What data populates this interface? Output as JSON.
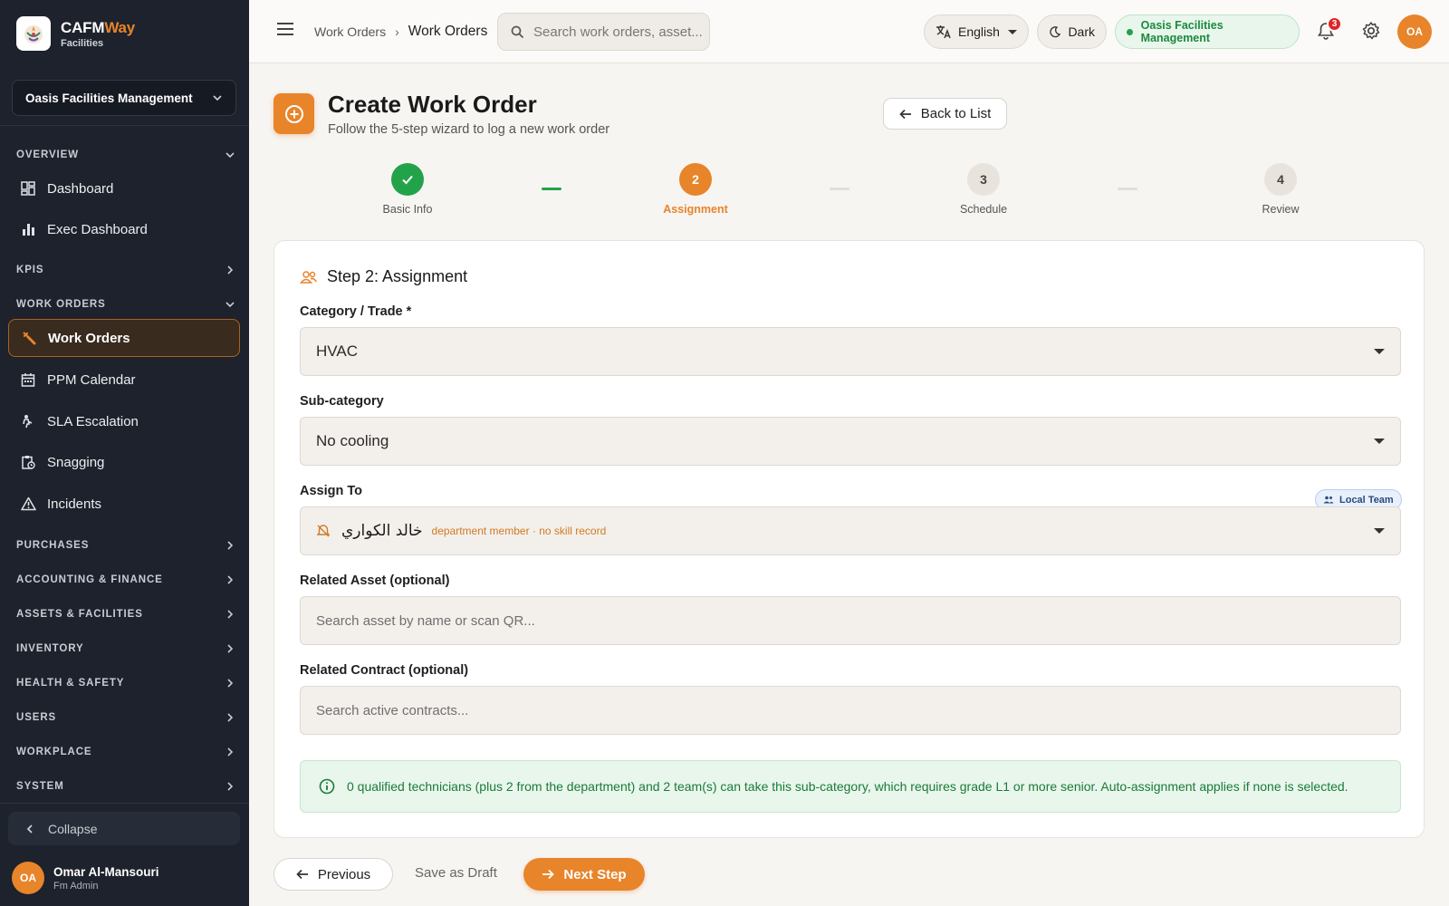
{
  "brand": {
    "name": "CAFM",
    "name_accent": "Way",
    "subtitle": "Facilities"
  },
  "sidebar": {
    "org_select": "Oasis Facilities Management",
    "sections": {
      "overview": "OVERVIEW",
      "kpis": "KPIS",
      "work_orders": "WORK ORDERS",
      "purchases": "PURCHASES",
      "accounting": "ACCOUNTING & FINANCE",
      "assets": "ASSETS & FACILITIES",
      "inventory": "INVENTORY",
      "health": "HEALTH & SAFETY",
      "users": "USERS",
      "workplace": "WORKPLACE",
      "system": "SYSTEM"
    },
    "items": {
      "dashboard": "Dashboard",
      "exec_dashboard": "Exec Dashboard",
      "work_orders": "Work Orders",
      "ppm_calendar": "PPM Calendar",
      "sla_escalation": "SLA Escalation",
      "snagging": "Snagging",
      "incidents": "Incidents"
    },
    "collapse": "Collapse",
    "user": {
      "initials": "OA",
      "name": "Omar Al-Mansouri",
      "role": "Fm Admin"
    }
  },
  "header": {
    "breadcrumb_parent": "Work Orders",
    "breadcrumb_current": "Work Orders",
    "search_placeholder": "Search work orders, asset...",
    "language": "English",
    "theme": "Dark",
    "org": "Oasis Facilities Management",
    "notification_count": "3",
    "avatar_initials": "OA"
  },
  "page": {
    "title": "Create Work Order",
    "subtitle": "Follow the 5-step wizard to log a new work order",
    "back_button": "Back to List"
  },
  "steps": [
    {
      "label": "Basic Info",
      "state": "done"
    },
    {
      "num": "2",
      "label": "Assignment",
      "state": "active"
    },
    {
      "num": "3",
      "label": "Schedule",
      "state": "todo"
    },
    {
      "num": "4",
      "label": "Review",
      "state": "todo"
    }
  ],
  "form": {
    "title": "Step 2: Assignment",
    "category_label": "Category / Trade *",
    "category_value": "HVAC",
    "subcategory_label": "Sub-category",
    "subcategory_value": "No cooling",
    "assign_label": "Assign To",
    "local_team_badge": "Local Team",
    "assignee_name": "خالد الكواري",
    "assignee_note": "department member · no skill record",
    "asset_label": "Related Asset (optional)",
    "asset_placeholder": "Search asset by name or scan QR...",
    "contract_label": "Related Contract (optional)",
    "contract_placeholder": "Search active contracts...",
    "info_text": "0 qualified technicians (plus 2 from the department) and 2 team(s) can take this sub-category, which requires grade L1 or more senior. Auto-assignment applies if none is selected."
  },
  "footer": {
    "previous": "Previous",
    "save_draft": "Save as Draft",
    "next": "Next Step"
  },
  "colors": {
    "accent": "#e8842a",
    "success": "#22a34a",
    "sidebar_bg": "#1d222c"
  }
}
